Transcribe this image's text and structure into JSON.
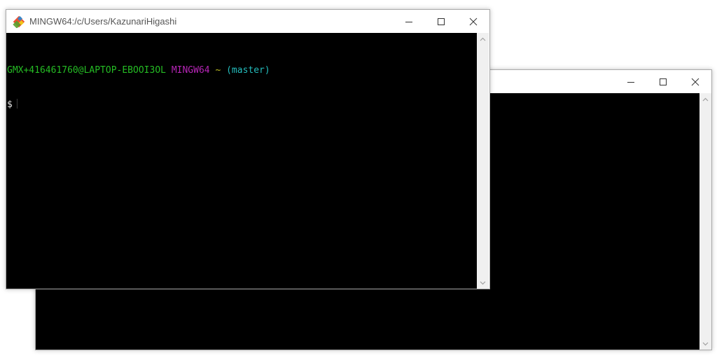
{
  "back_window": {
    "title": ""
  },
  "front_window": {
    "title": "MINGW64:/c/Users/KazunariHigashi",
    "icon": "git-icon",
    "prompt": {
      "user_host": "GMX+416461760@LAPTOP-EBOOI3OL",
      "system": "MINGW64",
      "path": "~",
      "branch": "(master)",
      "symbol": "$"
    }
  },
  "colors": {
    "user_host": "#25bc24",
    "system": "#b625b6",
    "path": "#bcbc24",
    "branch": "#24bcbc",
    "symbol": "#e0e0e0"
  }
}
